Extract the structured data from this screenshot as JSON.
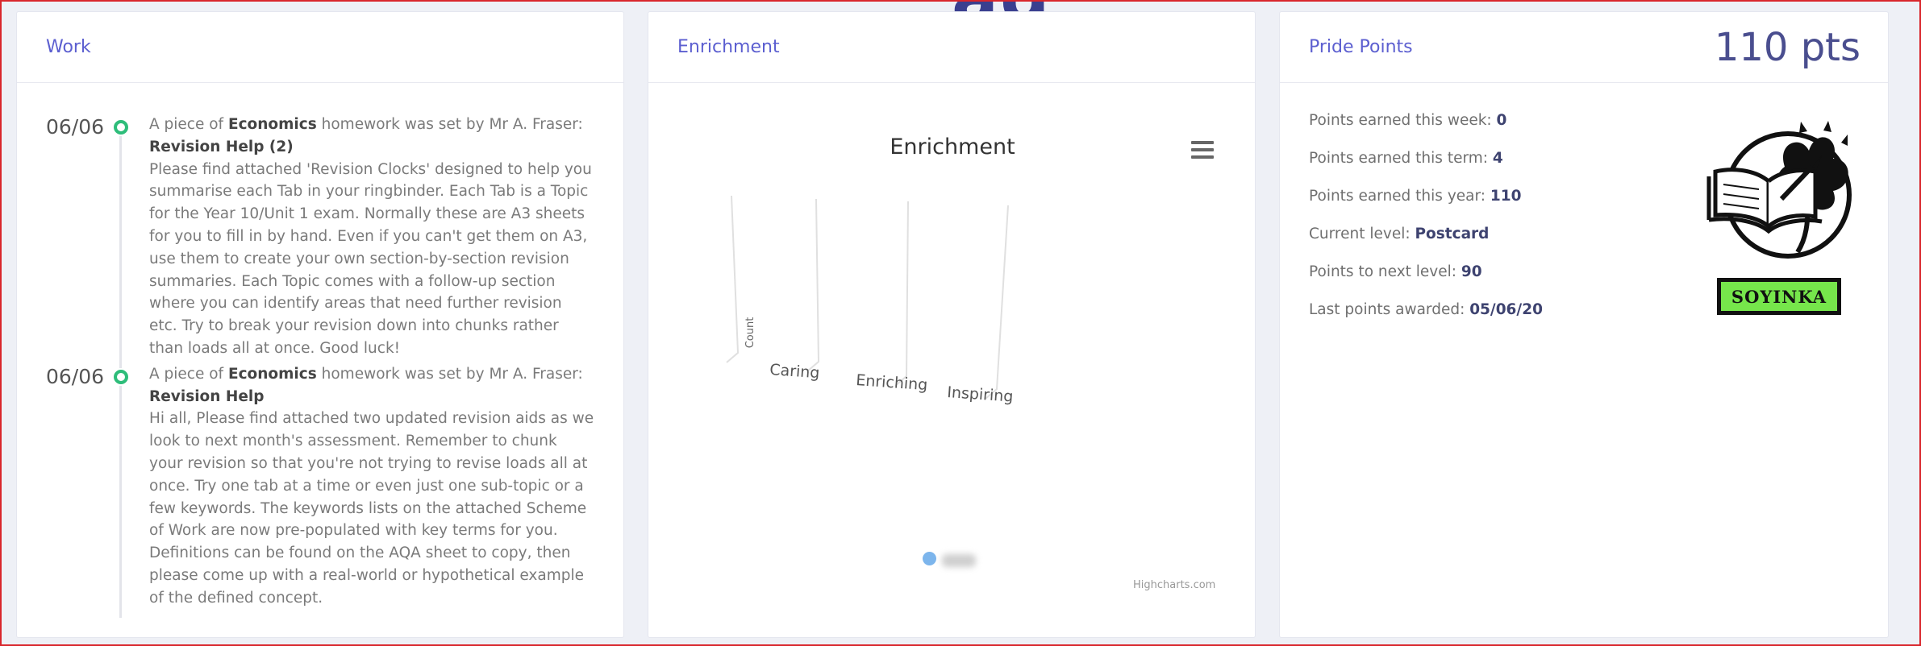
{
  "page": {
    "background_heading": "ag"
  },
  "colors": {
    "accent": "#5c5fd0",
    "timeline_dot": "#2ebd7a",
    "frame": "#d9262c",
    "badge_bg": "#76e64b",
    "series": "#7cb5ec"
  },
  "work": {
    "title": "Work",
    "items": [
      {
        "date": "06/06",
        "intro_pre": "A piece of ",
        "subject": "Economics",
        "intro_post": " homework was set by Mr A. Fraser:",
        "assignment": "Revision Help (2)",
        "description": "Please find attached 'Revision Clocks' designed to help you summarise each Tab in your ringbinder. Each Tab is a Topic for the Year 10/Unit 1 exam. Normally these are A3 sheets for you to fill in by hand. Even if you can't get them on A3, use them to create your own section-by-section revision summaries. Each Topic comes with a follow-up section where you can identify areas that need further revision etc. Try to break your revision down into chunks rather than loads all at once. Good luck!"
      },
      {
        "date": "06/06",
        "intro_pre": "A piece of ",
        "subject": "Economics",
        "intro_post": " homework was set by Mr A. Fraser:",
        "assignment": "Revision Help",
        "description": "Hi all, Please find attached two updated revision aids as we look to next month's assessment. Remember to chunk your revision so that you're not trying to revise loads all at once. Try one tab at a time or even just one sub-topic or a few keywords. The keywords lists on the attached Scheme of Work are now pre-populated with key terms for you. Definitions can be found on the AQA sheet to copy, then please come up with a real-world or hypothetical example of the defined concept."
      }
    ]
  },
  "enrichment": {
    "title": "Enrichment",
    "menu_icon": "hamburger-menu-icon",
    "credit": "Highcharts.com"
  },
  "chart_data": {
    "type": "bar",
    "title": "Enrichment",
    "ylabel": "Count",
    "xlabel": "",
    "categories": [
      "Caring",
      "Enriching",
      "Inspiring"
    ],
    "series": [
      {
        "values": [
          0,
          0,
          0
        ]
      }
    ],
    "legend": "bottom",
    "grid": true,
    "projection": "3d"
  },
  "pride": {
    "title": "Pride Points",
    "total": "110 pts",
    "rows": [
      {
        "label": "Points earned this week: ",
        "value": "0"
      },
      {
        "label": "Points earned this term: ",
        "value": "4"
      },
      {
        "label": "Points earned this year: ",
        "value": "110"
      },
      {
        "label": "Current level: ",
        "value": "Postcard"
      },
      {
        "label": "Points to next level: ",
        "value": "90"
      },
      {
        "label": "Last points awarded: ",
        "value": "05/06/20"
      }
    ],
    "house_badge": "SOYINKA",
    "house_icon": "book-and-tree-crest-icon"
  }
}
